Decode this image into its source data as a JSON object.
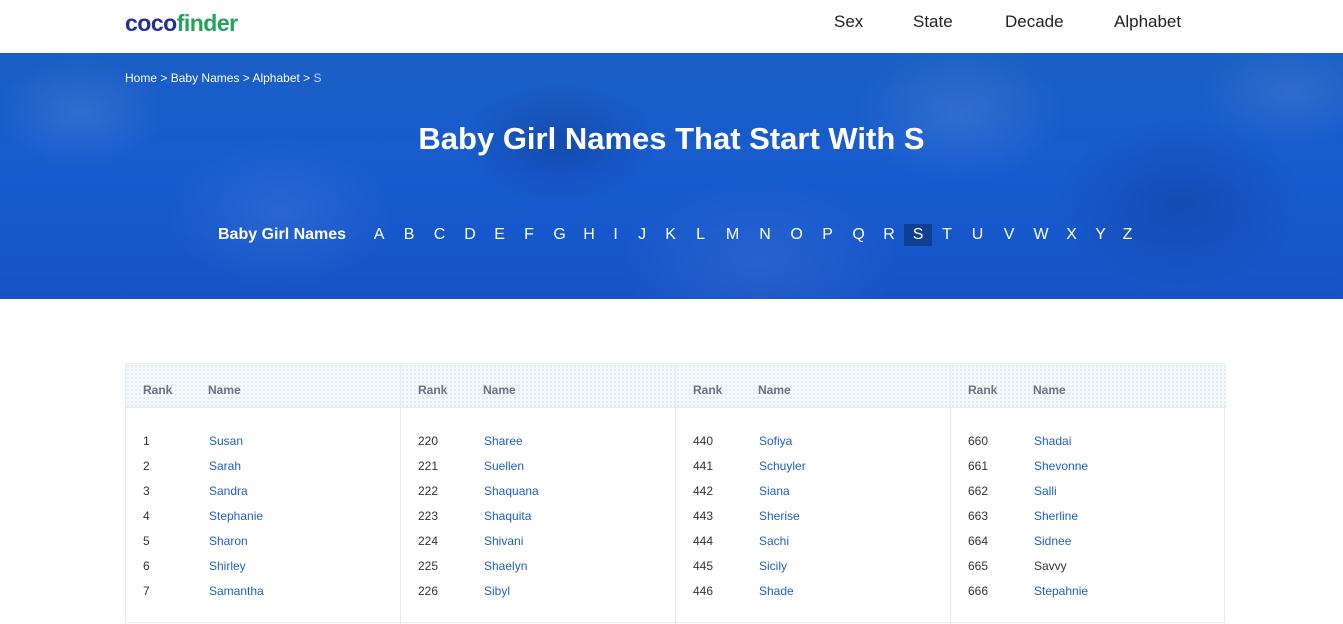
{
  "header": {
    "logo_part1": "coco",
    "logo_part2": "finder",
    "nav": [
      "Sex",
      "State",
      "Decade",
      "Alphabet"
    ]
  },
  "breadcrumb": {
    "items": [
      "Home",
      "Baby Names",
      "Alphabet"
    ],
    "separator": ">",
    "current": "S"
  },
  "hero": {
    "title": "Baby Girl Names That Start With S",
    "letters_label": "Baby Girl Names",
    "letters": [
      "A",
      "B",
      "C",
      "D",
      "E",
      "F",
      "G",
      "H",
      "I",
      "J",
      "K",
      "L",
      "M",
      "N",
      "O",
      "P",
      "Q",
      "R",
      "S",
      "T",
      "U",
      "V",
      "W",
      "X",
      "Y",
      "Z"
    ],
    "active_letter": "S"
  },
  "table": {
    "rank_header": "Rank",
    "name_header": "Name",
    "columns": [
      [
        {
          "rank": "1",
          "name": "Susan"
        },
        {
          "rank": "2",
          "name": "Sarah"
        },
        {
          "rank": "3",
          "name": "Sandra"
        },
        {
          "rank": "4",
          "name": "Stephanie"
        },
        {
          "rank": "5",
          "name": "Sharon"
        },
        {
          "rank": "6",
          "name": "Shirley"
        },
        {
          "rank": "7",
          "name": "Samantha"
        }
      ],
      [
        {
          "rank": "220",
          "name": "Sharee"
        },
        {
          "rank": "221",
          "name": "Suellen"
        },
        {
          "rank": "222",
          "name": "Shaquana"
        },
        {
          "rank": "223",
          "name": "Shaquita"
        },
        {
          "rank": "224",
          "name": "Shivani"
        },
        {
          "rank": "225",
          "name": "Shaelyn"
        },
        {
          "rank": "226",
          "name": "Sibyl"
        }
      ],
      [
        {
          "rank": "440",
          "name": "Sofiya"
        },
        {
          "rank": "441",
          "name": "Schuyler"
        },
        {
          "rank": "442",
          "name": "Siana"
        },
        {
          "rank": "443",
          "name": "Sherise"
        },
        {
          "rank": "444",
          "name": "Sachi"
        },
        {
          "rank": "445",
          "name": "Sicily"
        },
        {
          "rank": "446",
          "name": "Shade"
        }
      ],
      [
        {
          "rank": "660",
          "name": "Shadai"
        },
        {
          "rank": "661",
          "name": "Shevonne"
        },
        {
          "rank": "662",
          "name": "Salli"
        },
        {
          "rank": "663",
          "name": "Sherline"
        },
        {
          "rank": "664",
          "name": "Sidnee"
        },
        {
          "rank": "665",
          "name": "Savvy",
          "link": false
        },
        {
          "rank": "666",
          "name": "Stepahnie"
        }
      ]
    ]
  },
  "colors": {
    "hero_blue": "#175bd0",
    "link_blue": "#1f5fbf",
    "logo_navy": "#23308f",
    "logo_green": "#23a25a"
  }
}
